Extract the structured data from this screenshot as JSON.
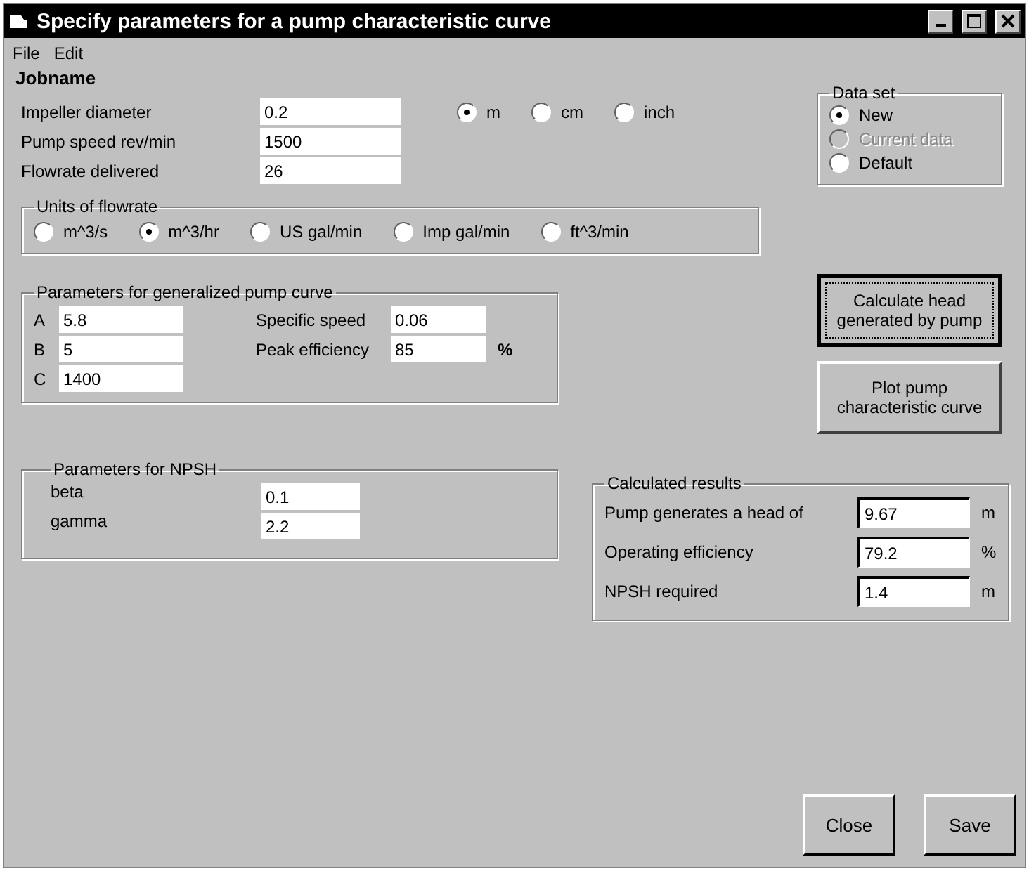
{
  "window": {
    "title": "Specify parameters for a pump characteristic curve"
  },
  "menu": [
    "File",
    "Edit"
  ],
  "jobname": "Jobname",
  "fields": [
    {
      "label": "Impeller diameter",
      "value": "0.2"
    },
    {
      "label": "Pump speed  rev/min",
      "value": "1500"
    },
    {
      "label": "Flowrate delivered",
      "value": "26"
    }
  ],
  "diameter_units": [
    {
      "label": "m",
      "selected": true
    },
    {
      "label": "cm",
      "selected": false
    },
    {
      "label": "inch",
      "selected": false
    }
  ],
  "data_set": {
    "title": "Data set",
    "options": [
      {
        "label": "New",
        "selected": true,
        "disabled": false
      },
      {
        "label": "Current data",
        "selected": false,
        "disabled": true
      },
      {
        "label": "Default",
        "selected": false,
        "disabled": false
      }
    ]
  },
  "flowrate_units": {
    "title": "Units of flowrate",
    "options": [
      {
        "label": "m^3/s",
        "selected": false
      },
      {
        "label": "m^3/hr",
        "selected": true
      },
      {
        "label": "US gal/min",
        "selected": false
      },
      {
        "label": "Imp gal/min",
        "selected": false
      },
      {
        "label": "ft^3/min",
        "selected": false
      }
    ]
  },
  "generalized": {
    "title": "Parameters for generalized pump curve",
    "coefficients": [
      {
        "label": "A",
        "value": "5.8"
      },
      {
        "label": "B",
        "value": "5"
      },
      {
        "label": "C",
        "value": "1400"
      }
    ],
    "specific_speed": {
      "label": "Specific speed",
      "value": "0.06"
    },
    "peak_efficiency": {
      "label": "Peak efficiency",
      "value": "85",
      "unit": "%"
    }
  },
  "actions": [
    {
      "label": "Calculate head generated by pump",
      "focused": true
    },
    {
      "label": "Plot pump characteristic curve",
      "focused": false
    }
  ],
  "npsh": {
    "title": "Parameters for NPSH",
    "params": [
      {
        "label": "beta",
        "value": "0.1"
      },
      {
        "label": "gamma",
        "value": "2.2"
      }
    ]
  },
  "results": {
    "title": "Calculated results",
    "rows": [
      {
        "label": "Pump generates a head of",
        "value": "9.67",
        "unit": "m"
      },
      {
        "label": "Operating efficiency",
        "value": "79.2",
        "unit": "%"
      },
      {
        "label": "NPSH required",
        "value": "1.4",
        "unit": "m"
      }
    ]
  },
  "footer_buttons": [
    "Close",
    "Save"
  ]
}
